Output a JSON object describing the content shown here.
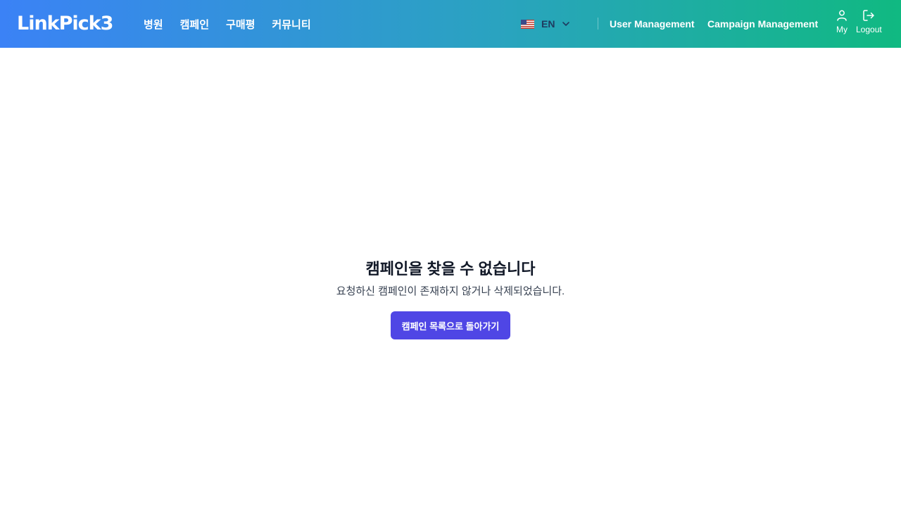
{
  "header": {
    "logo": "LinkPick3",
    "nav": [
      "병원",
      "캠페인",
      "구매평",
      "커뮤니티"
    ],
    "language": {
      "code": "EN",
      "flag_icon": "us-flag-icon"
    },
    "admin_links": [
      "User Management",
      "Campaign Management"
    ],
    "my_label": "My",
    "logout_label": "Logout"
  },
  "main": {
    "title": "캠페인을 찾을 수 없습니다",
    "subtitle": "요청하신 캠페인이 존재하지 않거나 삭제되었습니다.",
    "back_button": "캠페인 목록으로 돌아가기"
  },
  "colors": {
    "header_gradient_start": "#3b82f6",
    "header_gradient_end": "#10b981",
    "primary_button": "#4f46e5"
  }
}
